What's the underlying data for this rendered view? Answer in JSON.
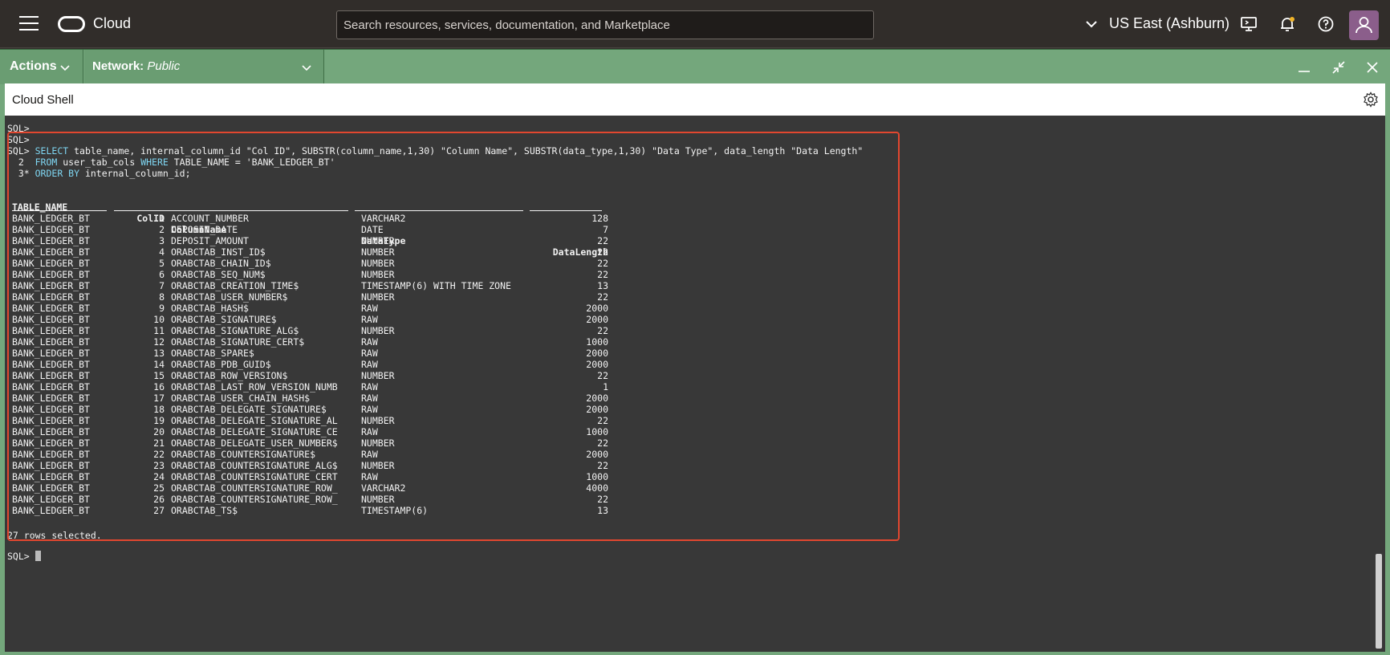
{
  "topbar": {
    "brand": "Cloud",
    "search_placeholder": "Search resources, services, documentation, and Marketplace",
    "region": "US East (Ashburn)",
    "icons": [
      "menu-icon",
      "oracle-logo-icon",
      "chevron-down-icon",
      "cloud-shell-icon",
      "bell-icon",
      "help-icon",
      "user-avatar-icon"
    ]
  },
  "shellbar": {
    "actions_label": "Actions",
    "network_label": "Network:",
    "network_value": "Public",
    "icons": [
      "minimize-icon",
      "restore-icon",
      "close-icon"
    ]
  },
  "shell": {
    "title": "Cloud Shell",
    "settings_icon": "gear-icon"
  },
  "terminal": {
    "prompt_lines": [
      "SQL>",
      "SQL>"
    ],
    "query_line1_prompt": "SQL> ",
    "query_line1_kw": "SELECT",
    "query_line1_rest": " table_name, internal_column_id \"Col ID\", SUBSTR(column_name,1,30) \"Column Name\", SUBSTR(data_type,1,30) \"Data Type\", data_length \"Data Length\"",
    "query_line2_prefix": "  2  ",
    "query_line2_kw1": "FROM",
    "query_line2_mid": " user_tab_cols ",
    "query_line2_kw2": "WHERE",
    "query_line2_rest": " TABLE_NAME = 'BANK_LEDGER_BT'",
    "query_line3_prefix": "  3* ",
    "query_line3_kw": "ORDER BY",
    "query_line3_rest": " internal_column_id;",
    "headers": [
      "TABLE_NAME",
      "ColID",
      "ColumnName",
      "DataType",
      "DataLength"
    ],
    "rows": [
      [
        "BANK_LEDGER_BT",
        "1",
        "ACCOUNT_NUMBER",
        "VARCHAR2",
        "128"
      ],
      [
        "BANK_LEDGER_BT",
        "2",
        "DEPOSIT_DATE",
        "DATE",
        "7"
      ],
      [
        "BANK_LEDGER_BT",
        "3",
        "DEPOSIT_AMOUNT",
        "NUMBER",
        "22"
      ],
      [
        "BANK_LEDGER_BT",
        "4",
        "ORABCTAB_INST_ID$",
        "NUMBER",
        "22"
      ],
      [
        "BANK_LEDGER_BT",
        "5",
        "ORABCTAB_CHAIN_ID$",
        "NUMBER",
        "22"
      ],
      [
        "BANK_LEDGER_BT",
        "6",
        "ORABCTAB_SEQ_NUM$",
        "NUMBER",
        "22"
      ],
      [
        "BANK_LEDGER_BT",
        "7",
        "ORABCTAB_CREATION_TIME$",
        "TIMESTAMP(6) WITH TIME ZONE",
        "13"
      ],
      [
        "BANK_LEDGER_BT",
        "8",
        "ORABCTAB_USER_NUMBER$",
        "NUMBER",
        "22"
      ],
      [
        "BANK_LEDGER_BT",
        "9",
        "ORABCTAB_HASH$",
        "RAW",
        "2000"
      ],
      [
        "BANK_LEDGER_BT",
        "10",
        "ORABCTAB_SIGNATURE$",
        "RAW",
        "2000"
      ],
      [
        "BANK_LEDGER_BT",
        "11",
        "ORABCTAB_SIGNATURE_ALG$",
        "NUMBER",
        "22"
      ],
      [
        "BANK_LEDGER_BT",
        "12",
        "ORABCTAB_SIGNATURE_CERT$",
        "RAW",
        "1000"
      ],
      [
        "BANK_LEDGER_BT",
        "13",
        "ORABCTAB_SPARE$",
        "RAW",
        "2000"
      ],
      [
        "BANK_LEDGER_BT",
        "14",
        "ORABCTAB_PDB_GUID$",
        "RAW",
        "2000"
      ],
      [
        "BANK_LEDGER_BT",
        "15",
        "ORABCTAB_ROW_VERSION$",
        "NUMBER",
        "22"
      ],
      [
        "BANK_LEDGER_BT",
        "16",
        "ORABCTAB_LAST_ROW_VERSION_NUMB",
        "RAW",
        "1"
      ],
      [
        "BANK_LEDGER_BT",
        "17",
        "ORABCTAB_USER_CHAIN_HASH$",
        "RAW",
        "2000"
      ],
      [
        "BANK_LEDGER_BT",
        "18",
        "ORABCTAB_DELEGATE_SIGNATURE$",
        "RAW",
        "2000"
      ],
      [
        "BANK_LEDGER_BT",
        "19",
        "ORABCTAB_DELEGATE_SIGNATURE_AL",
        "NUMBER",
        "22"
      ],
      [
        "BANK_LEDGER_BT",
        "20",
        "ORABCTAB_DELEGATE_SIGNATURE_CE",
        "RAW",
        "1000"
      ],
      [
        "BANK_LEDGER_BT",
        "21",
        "ORABCTAB_DELEGATE_USER_NUMBER$",
        "NUMBER",
        "22"
      ],
      [
        "BANK_LEDGER_BT",
        "22",
        "ORABCTAB_COUNTERSIGNATURE$",
        "RAW",
        "2000"
      ],
      [
        "BANK_LEDGER_BT",
        "23",
        "ORABCTAB_COUNTERSIGNATURE_ALG$",
        "NUMBER",
        "22"
      ],
      [
        "BANK_LEDGER_BT",
        "24",
        "ORABCTAB_COUNTERSIGNATURE_CERT",
        "RAW",
        "1000"
      ],
      [
        "BANK_LEDGER_BT",
        "25",
        "ORABCTAB_COUNTERSIGNATURE_ROW_",
        "VARCHAR2",
        "4000"
      ],
      [
        "BANK_LEDGER_BT",
        "26",
        "ORABCTAB_COUNTERSIGNATURE_ROW_",
        "NUMBER",
        "22"
      ],
      [
        "BANK_LEDGER_BT",
        "27",
        "ORABCTAB_TS$",
        "TIMESTAMP(6)",
        "13"
      ]
    ],
    "footer": "27 rows selected.",
    "final_prompt": "SQL> "
  },
  "colors": {
    "topbar_bg": "#312d2a",
    "shellbar_green": "#74a77c",
    "terminal_bg": "#383838",
    "highlight_red": "#e2472f",
    "keyword_cyan": "#7fd6f2"
  }
}
